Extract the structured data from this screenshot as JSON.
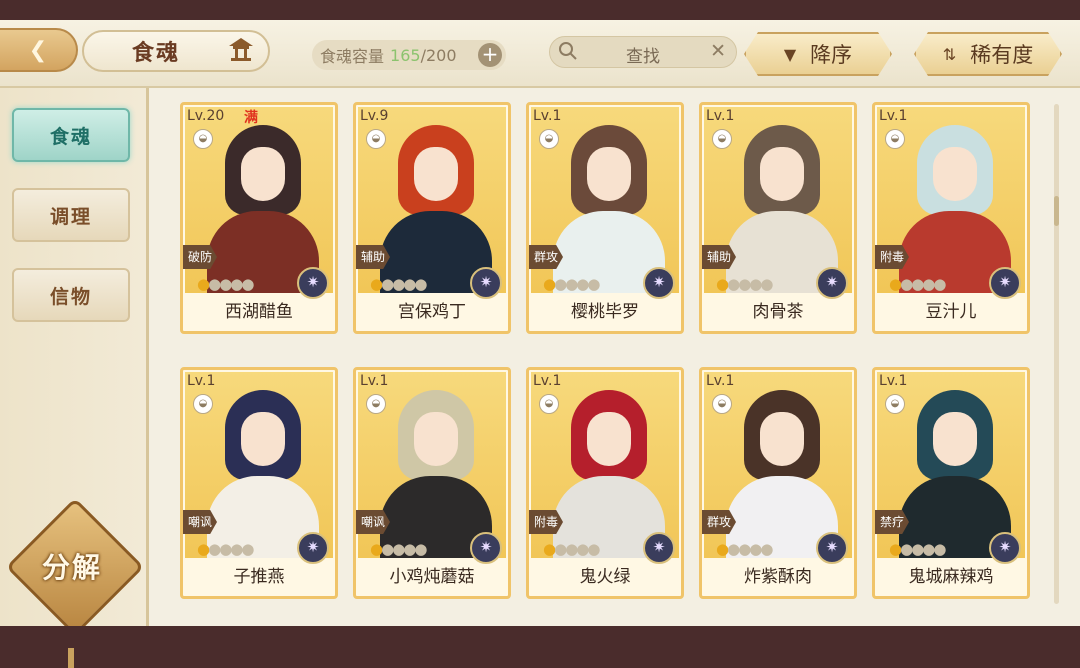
{
  "header": {
    "title": "食魂",
    "capacity_label": "食魂容量",
    "capacity_current": "165",
    "capacity_max": "/200",
    "search_label": "查找",
    "sort_desc_label": "降序",
    "sort_rarity_label": "稀有度"
  },
  "sidebar": {
    "items": [
      {
        "label": "食魂",
        "active": true
      },
      {
        "label": "调理",
        "active": false
      },
      {
        "label": "信物",
        "active": false
      }
    ],
    "decompose_label": "分解"
  },
  "cards": [
    {
      "level": "Lv.20",
      "full": "满",
      "role": "破防",
      "name": "西湖醋鱼",
      "stars": 1,
      "hair": "#3b2a2a",
      "outfit": "#7c2f25"
    },
    {
      "level": "Lv.9",
      "role": "辅助",
      "name": "宫保鸡丁",
      "stars": 1,
      "hair": "#c9401e",
      "outfit": "#1d2a3a"
    },
    {
      "level": "Lv.1",
      "role": "群攻",
      "name": "樱桃毕罗",
      "stars": 1,
      "hair": "#6b4a3a",
      "outfit": "#e9f0ee"
    },
    {
      "level": "Lv.1",
      "role": "辅助",
      "name": "肉骨茶",
      "stars": 1,
      "hair": "#6d5a4a",
      "outfit": "#e7e1d4"
    },
    {
      "level": "Lv.1",
      "role": "附毒",
      "name": "豆汁儿",
      "stars": 1,
      "hair": "#c9dfe0",
      "outfit": "#b93a2e"
    },
    {
      "level": "Lv.1",
      "role": "嘲讽",
      "name": "子推燕",
      "stars": 1,
      "hair": "#2b2f55",
      "outfit": "#f3efe6"
    },
    {
      "level": "Lv.1",
      "role": "嘲讽",
      "name": "小鸡炖蘑菇",
      "stars": 1,
      "hair": "#cfc7a6",
      "outfit": "#2c2a2a"
    },
    {
      "level": "Lv.1",
      "role": "附毒",
      "name": "鬼火绿",
      "stars": 1,
      "hair": "#b51f2c",
      "outfit": "#e4e2dc"
    },
    {
      "level": "Lv.1",
      "role": "群攻",
      "name": "炸紫酥肉",
      "stars": 1,
      "hair": "#4a3328",
      "outfit": "#f1f0f2"
    },
    {
      "level": "Lv.1",
      "role": "禁疗",
      "name": "鬼城麻辣鸡",
      "stars": 1,
      "hair": "#244a57",
      "outfit": "#1f2a2e"
    }
  ],
  "colors": {
    "frame": "#4a2c2c",
    "card_border": "#f0c469",
    "active_tab": "#9fd4c8",
    "capacity_current": "#8cc36e"
  }
}
